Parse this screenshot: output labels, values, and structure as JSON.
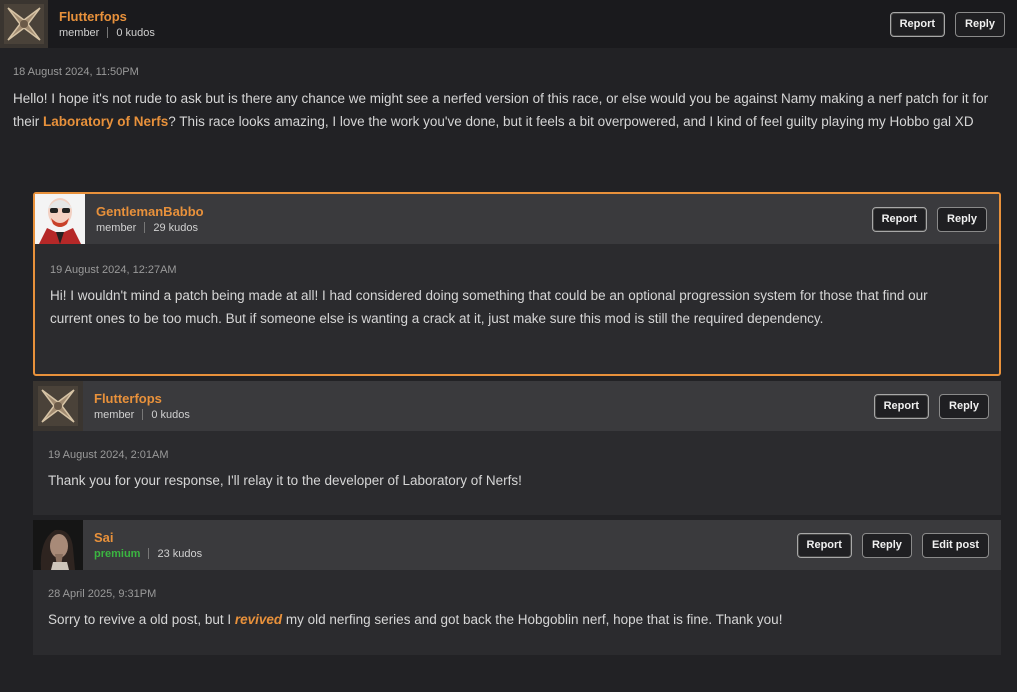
{
  "posts": [
    {
      "username": "Flutterfops",
      "role": "member",
      "kudos": "0 kudos",
      "date": "18 August 2024, 11:50PM",
      "text_before": "Hello! I hope it's not rude to ask but is there any chance we might see a nerfed version of this race, or else would you be against Namy making a nerf patch for it for their ",
      "link": "Laboratory of Nerfs",
      "text_after": "?  This race looks amazing, I love the work you've done, but it feels a bit overpowered, and I kind of feel guilty playing my Hobbo gal XD",
      "report_label": "Report",
      "reply_label": "Reply"
    },
    {
      "username": "GentlemanBabbo",
      "role": "member",
      "kudos": "29 kudos",
      "date": "19 August 2024, 12:27AM",
      "text": "Hi! I wouldn't mind a patch being made at all! I had considered doing something that could be an optional progression system for those that find our current ones to be too much. But if someone else is wanting a crack at it, just make sure this mod is still the required dependency.",
      "report_label": "Report",
      "reply_label": "Reply"
    },
    {
      "username": "Flutterfops",
      "role": "member",
      "kudos": "0 kudos",
      "date": "19 August 2024, 2:01AM",
      "text": "Thank you for your response, I'll relay it to the developer of Laboratory of Nerfs!",
      "report_label": "Report",
      "reply_label": "Reply"
    },
    {
      "username": "Sai",
      "role": "premium",
      "kudos": "23 kudos",
      "date": "28 April 2025, 9:31PM",
      "text_before": "Sorry to revive a old post, but I ",
      "emphasis": "revived",
      "text_after": " my old nerfing series and got back the Hobgoblin nerf, hope that is fine. Thank you!",
      "report_label": "Report",
      "reply_label": "Reply",
      "edit_label": "Edit post"
    }
  ],
  "colors": {
    "accent": "#e8913b",
    "premium": "#3bb541",
    "highlight_border": "#e8913b"
  }
}
